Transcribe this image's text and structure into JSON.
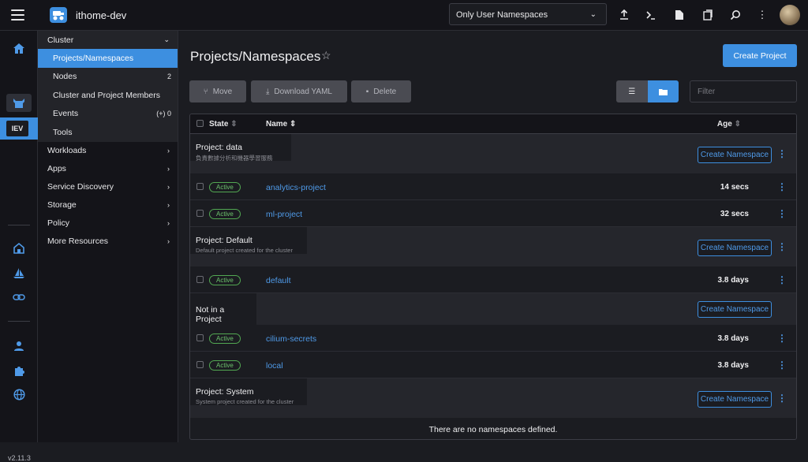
{
  "header": {
    "cluster_name": "ithome-dev",
    "namespace_filter": "Only User Namespaces",
    "icons": [
      "upload-icon",
      "terminal-icon",
      "file-icon",
      "copy-icon",
      "search-icon",
      "more-vertical-icon"
    ]
  },
  "rail": {
    "cluster_badge": "IEV",
    "version": "v2.11.3"
  },
  "sidebar": {
    "cluster": {
      "label": "Cluster",
      "items": [
        {
          "label": "Projects/Namespaces",
          "count": ""
        },
        {
          "label": "Nodes",
          "count": "2"
        },
        {
          "label": "Cluster and Project Members",
          "count": ""
        },
        {
          "label": "Events",
          "count": "(+) 0"
        },
        {
          "label": "Tools",
          "count": ""
        }
      ]
    },
    "groups": [
      "Workloads",
      "Apps",
      "Service Discovery",
      "Storage",
      "Policy",
      "More Resources"
    ]
  },
  "main": {
    "title": "Projects/Namespaces",
    "create_project": "Create Project",
    "actions": {
      "move": "Move",
      "download": "Download YAML",
      "delete": "Delete"
    },
    "filter_placeholder": "Filter",
    "columns": {
      "state": "State",
      "name": "Name",
      "age": "Age"
    },
    "create_namespace": "Create Namespace",
    "groups": [
      {
        "title": "Project:  data",
        "subtitle": "負責數據分析和機器學習服務",
        "rows": [
          {
            "state": "Active",
            "name": "analytics-project",
            "age": "14 secs"
          },
          {
            "state": "Active",
            "name": "ml-project",
            "age": "32 secs"
          }
        ]
      },
      {
        "title": "Project:  Default",
        "subtitle": "Default project created for the cluster",
        "rows": [
          {
            "state": "Active",
            "name": "default",
            "age": "3.8 days"
          }
        ]
      },
      {
        "title": "Not in a Project",
        "subtitle": "",
        "rows": [
          {
            "state": "Active",
            "name": "cilium-secrets",
            "age": "3.8 days"
          },
          {
            "state": "Active",
            "name": "local",
            "age": "3.8 days"
          }
        ]
      },
      {
        "title": "Project:  System",
        "subtitle": "System project created for the cluster",
        "rows": []
      }
    ],
    "empty_message": "There are no namespaces defined."
  },
  "colors": {
    "accent": "#3d8fe0",
    "active_badge": "#52a852"
  }
}
